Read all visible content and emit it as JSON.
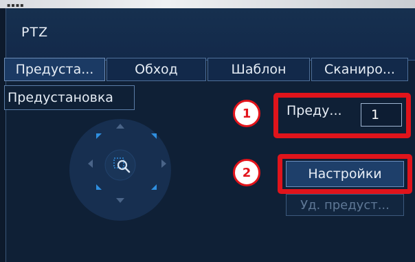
{
  "window": {
    "title": "PTZ"
  },
  "tabs": [
    {
      "label": "Предуста...",
      "active": true
    },
    {
      "label": "Обход",
      "active": false
    },
    {
      "label": "Шаблон",
      "active": false
    },
    {
      "label": "Сканиро...",
      "active": false
    }
  ],
  "section": {
    "label": "Предустановка"
  },
  "preset": {
    "label": "Преду...",
    "value": "1"
  },
  "buttons": {
    "settings": "Настройки",
    "delete_preset": "Уд. предуст..."
  },
  "annotations": {
    "marker1": "1",
    "marker2": "2"
  },
  "colors": {
    "accent_red": "#e0141b",
    "joystick_blue": "#2f8fe0"
  }
}
